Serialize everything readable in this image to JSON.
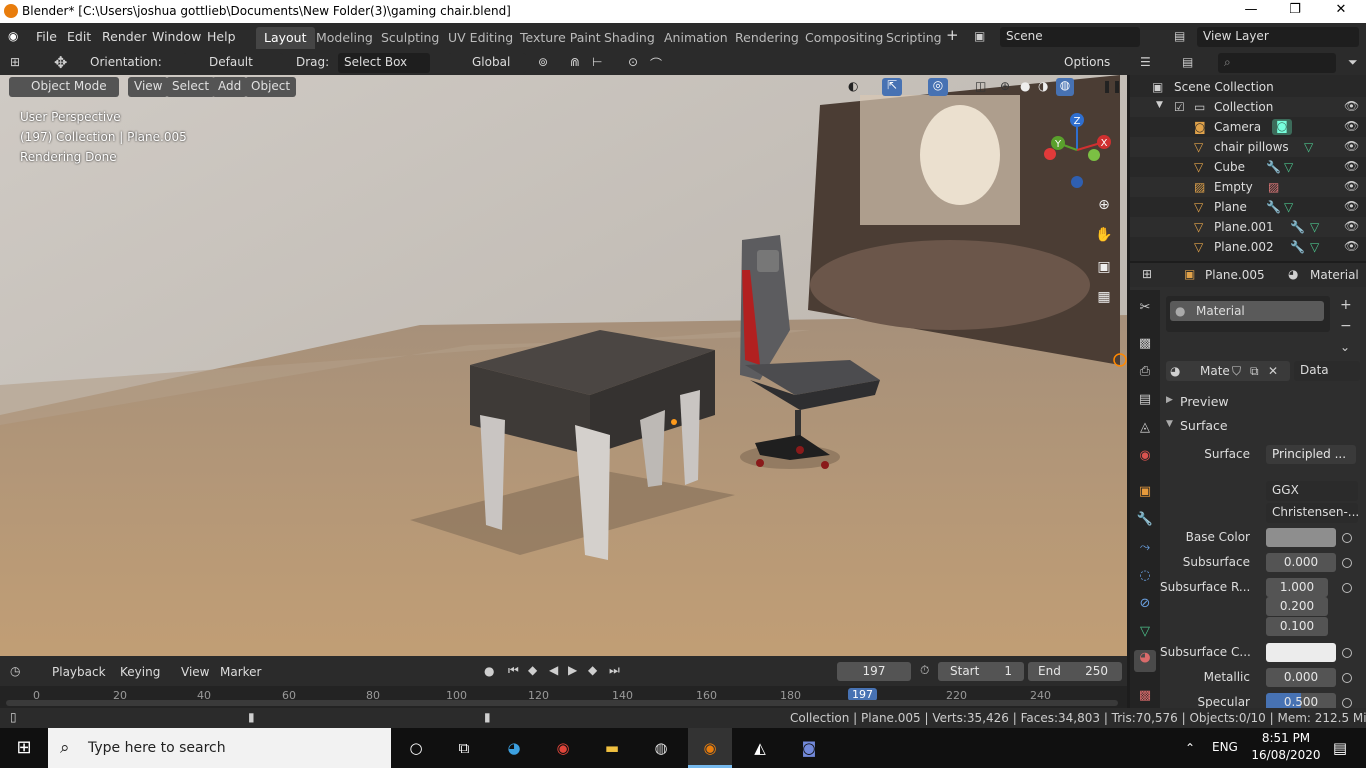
{
  "window": {
    "title": "Blender* [C:\\Users\\joshua gottlieb\\Documents\\New Folder(3)\\gaming chair.blend]",
    "minimize": "—",
    "maximize": "❐",
    "close": "✕"
  },
  "menu": [
    "File",
    "Edit",
    "Render",
    "Window",
    "Help"
  ],
  "workspaces": [
    "Layout",
    "Modeling",
    "Sculpting",
    "UV Editing",
    "Texture Paint",
    "Shading",
    "Animation",
    "Rendering",
    "Compositing",
    "Scripting"
  ],
  "active_workspace": "Layout",
  "add_workspace": "+",
  "scene": {
    "name": "Scene",
    "view_layer": "View Layer"
  },
  "tool_header": {
    "orientation_label": "Orientation:",
    "orientation_value": "Default",
    "drag_label": "Drag:",
    "drag_value": "Select Box",
    "transform_value": "Global",
    "options": "Options"
  },
  "viewport_header": {
    "mode": "Object Mode",
    "menus": [
      "View",
      "Select",
      "Add",
      "Object"
    ]
  },
  "viewport_info": {
    "line1": "User Perspective",
    "line2": "(197) Collection | Plane.005",
    "line3": "Rendering Done"
  },
  "gizmo": {
    "x": "X",
    "y": "Y",
    "z": "Z"
  },
  "timeline": {
    "menus": [
      "Playback",
      "Keying",
      "View",
      "Marker"
    ],
    "current_frame": "197",
    "start_label": "Start",
    "start": "1",
    "end_label": "End",
    "end": "250",
    "ticks": [
      "0",
      "20",
      "40",
      "60",
      "80",
      "100",
      "120",
      "140",
      "160",
      "180",
      "197",
      "220",
      "240"
    ]
  },
  "statusbar": {
    "text": "Collection | Plane.005 | Verts:35,426 | Faces:34,803 | Tris:70,576 | Objects:0/10 | Mem: 212.5 MiB | 2.83.3"
  },
  "outliner": {
    "root": "Scene Collection",
    "collection": "Collection",
    "items": [
      "Camera",
      "chair pillows",
      "Cube",
      "Empty",
      "Plane",
      "Plane.001",
      "Plane.002"
    ]
  },
  "properties": {
    "object": "Plane.005",
    "context": "Material",
    "slot": "Material",
    "material_name": "Mate",
    "link": "Data",
    "preview": "Preview",
    "surface_panel": "Surface",
    "surface_label": "Surface",
    "surface_value": "Principled ...",
    "distribution": "GGX",
    "subsurface_method": "Christensen-...",
    "fields": {
      "base_color": "Base Color",
      "subsurface": "Subsurface",
      "subsurface_v": "0.000",
      "subsurface_r": "Subsurface R...",
      "sr1": "1.000",
      "sr2": "0.200",
      "sr3": "0.100",
      "subsurface_c": "Subsurface C...",
      "metallic": "Metallic",
      "metallic_v": "0.000",
      "specular": "Specular",
      "specular_v": "0.500"
    }
  },
  "taskbar": {
    "search_placeholder": "Type here to search",
    "time": "8:51 PM",
    "date": "16/08/2020",
    "lang": "ENG"
  }
}
